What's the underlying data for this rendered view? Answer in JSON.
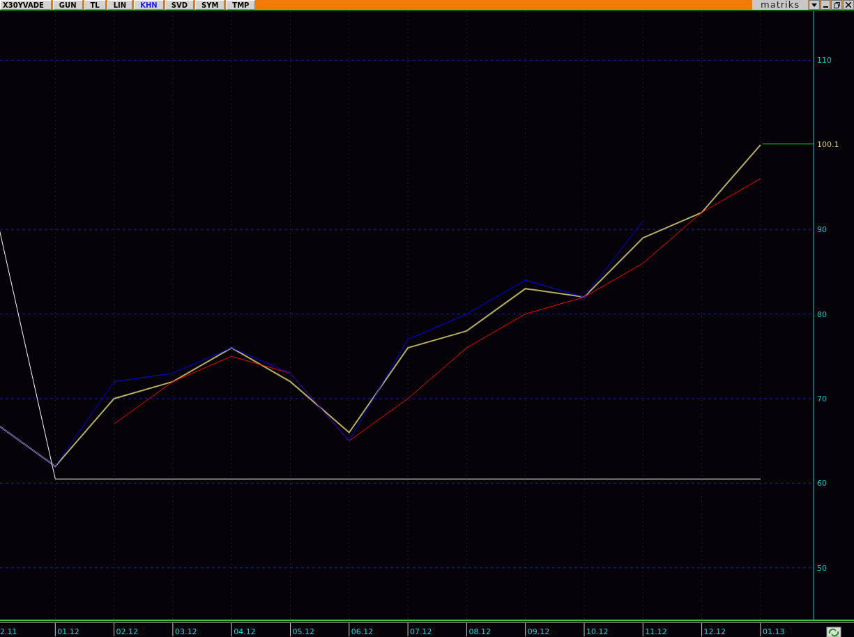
{
  "toolbar": {
    "buttons": [
      {
        "label": "X30YVADE",
        "selected": false
      },
      {
        "label": "GUN",
        "selected": false
      },
      {
        "label": "TL",
        "selected": false
      },
      {
        "label": "LIN",
        "selected": false
      },
      {
        "label": "KHN",
        "selected": true
      },
      {
        "label": "SVD",
        "selected": false
      },
      {
        "label": "SYM",
        "selected": false
      },
      {
        "label": "TMP",
        "selected": false
      }
    ],
    "brand": "matriks"
  },
  "chart": {
    "last_price": "100.1",
    "chart_data": {
      "type": "line",
      "grid": true,
      "categories": [
        "2.11",
        "01.12",
        "02.12",
        "03.12",
        "04.12",
        "05.12",
        "06.12",
        "07.12",
        "08.12",
        "09.12",
        "10.12",
        "11.12",
        "12.12",
        "01.13"
      ],
      "ylim": [
        43.8,
        115.8
      ],
      "yticks": [
        50,
        60,
        70,
        80,
        90,
        110
      ],
      "series": [
        {
          "color": "#b8b060",
          "values": [
            67,
            62,
            70,
            72,
            76,
            72,
            66,
            76,
            78,
            83,
            82,
            89,
            92,
            100
          ]
        },
        {
          "color": "#ff0000",
          "values": [
            null,
            null,
            67,
            72,
            75,
            73,
            65,
            70,
            76,
            80,
            82,
            86,
            92,
            96
          ]
        },
        {
          "color": "#0000ff",
          "values": [
            67,
            62,
            72,
            73,
            76,
            73,
            65,
            77,
            80,
            84,
            82,
            91,
            null,
            null
          ]
        },
        {
          "color": "#ffffff",
          "values": [
            91.5,
            60.5,
            60.5,
            60.5,
            60.5,
            60.5,
            60.5,
            60.5,
            60.5,
            60.5,
            60.5,
            60.5,
            60.5,
            60.5
          ]
        }
      ]
    }
  }
}
